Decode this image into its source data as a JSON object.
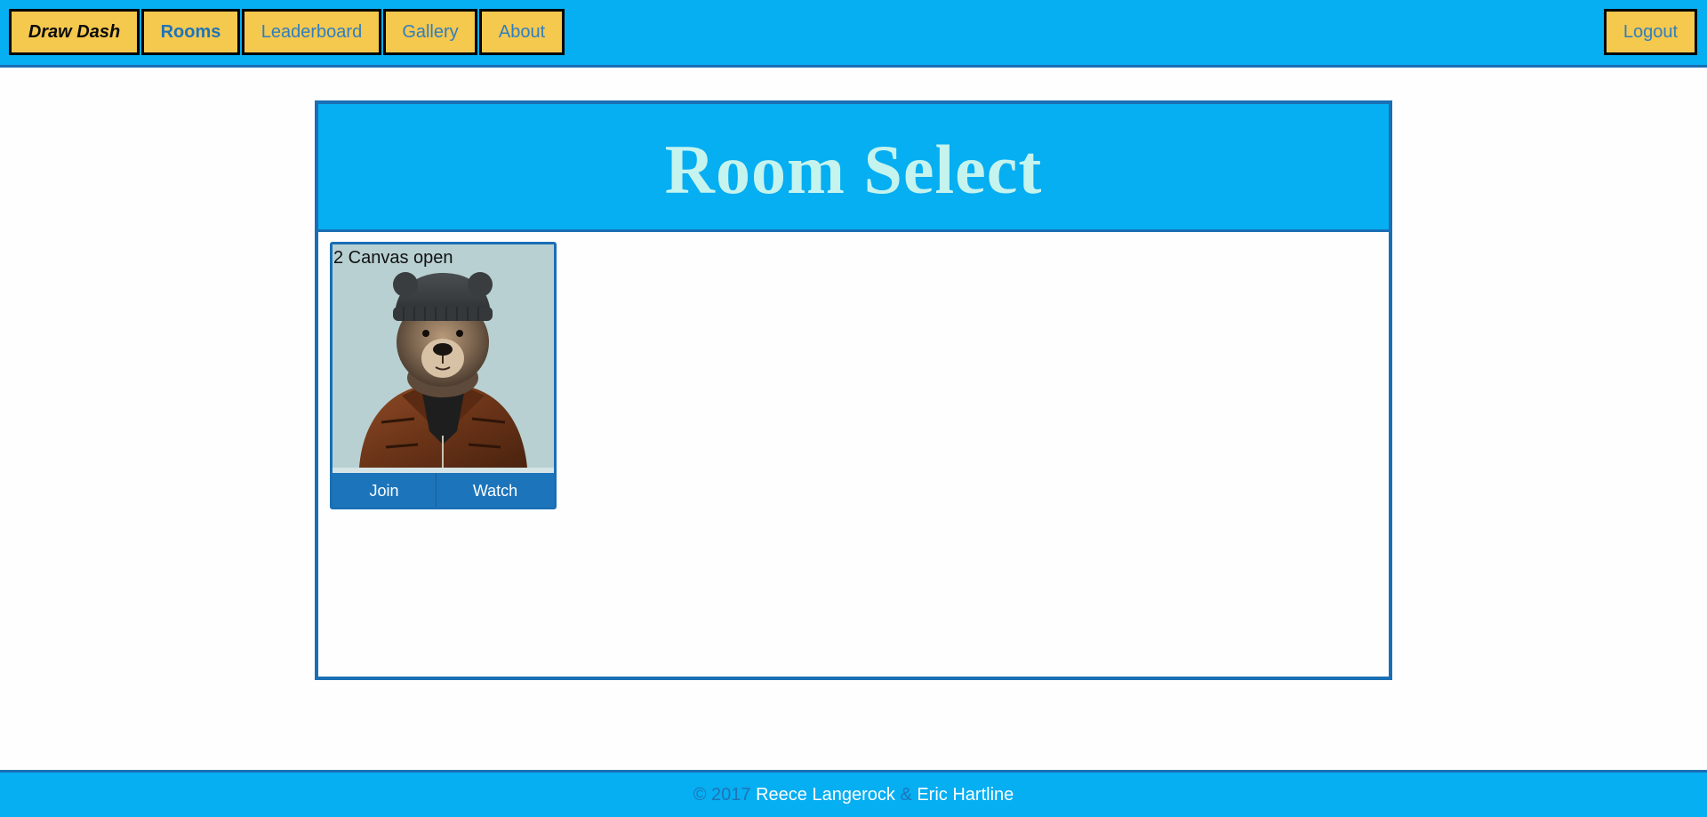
{
  "nav": {
    "brand": "Draw Dash",
    "items": [
      {
        "label": "Rooms",
        "active": true
      },
      {
        "label": "Leaderboard",
        "active": false
      },
      {
        "label": "Gallery",
        "active": false
      },
      {
        "label": "About",
        "active": false
      }
    ],
    "logout": "Logout"
  },
  "panel": {
    "title": "Room Select"
  },
  "rooms": [
    {
      "status": "2 Canvas open",
      "image": "bear-in-beanie-and-leather-jacket",
      "join_label": "Join",
      "watch_label": "Watch"
    }
  ],
  "footer": {
    "copyright": "© 2017",
    "author1": "Reece Langerock",
    "separator": "&",
    "author2": "Eric Hartline"
  },
  "colors": {
    "nav_background": "#06aef2",
    "nav_button": "#f5c84e",
    "border_accent": "#1a6fb5",
    "title_text": "#c5f3ee",
    "room_button": "#1c75ba"
  }
}
